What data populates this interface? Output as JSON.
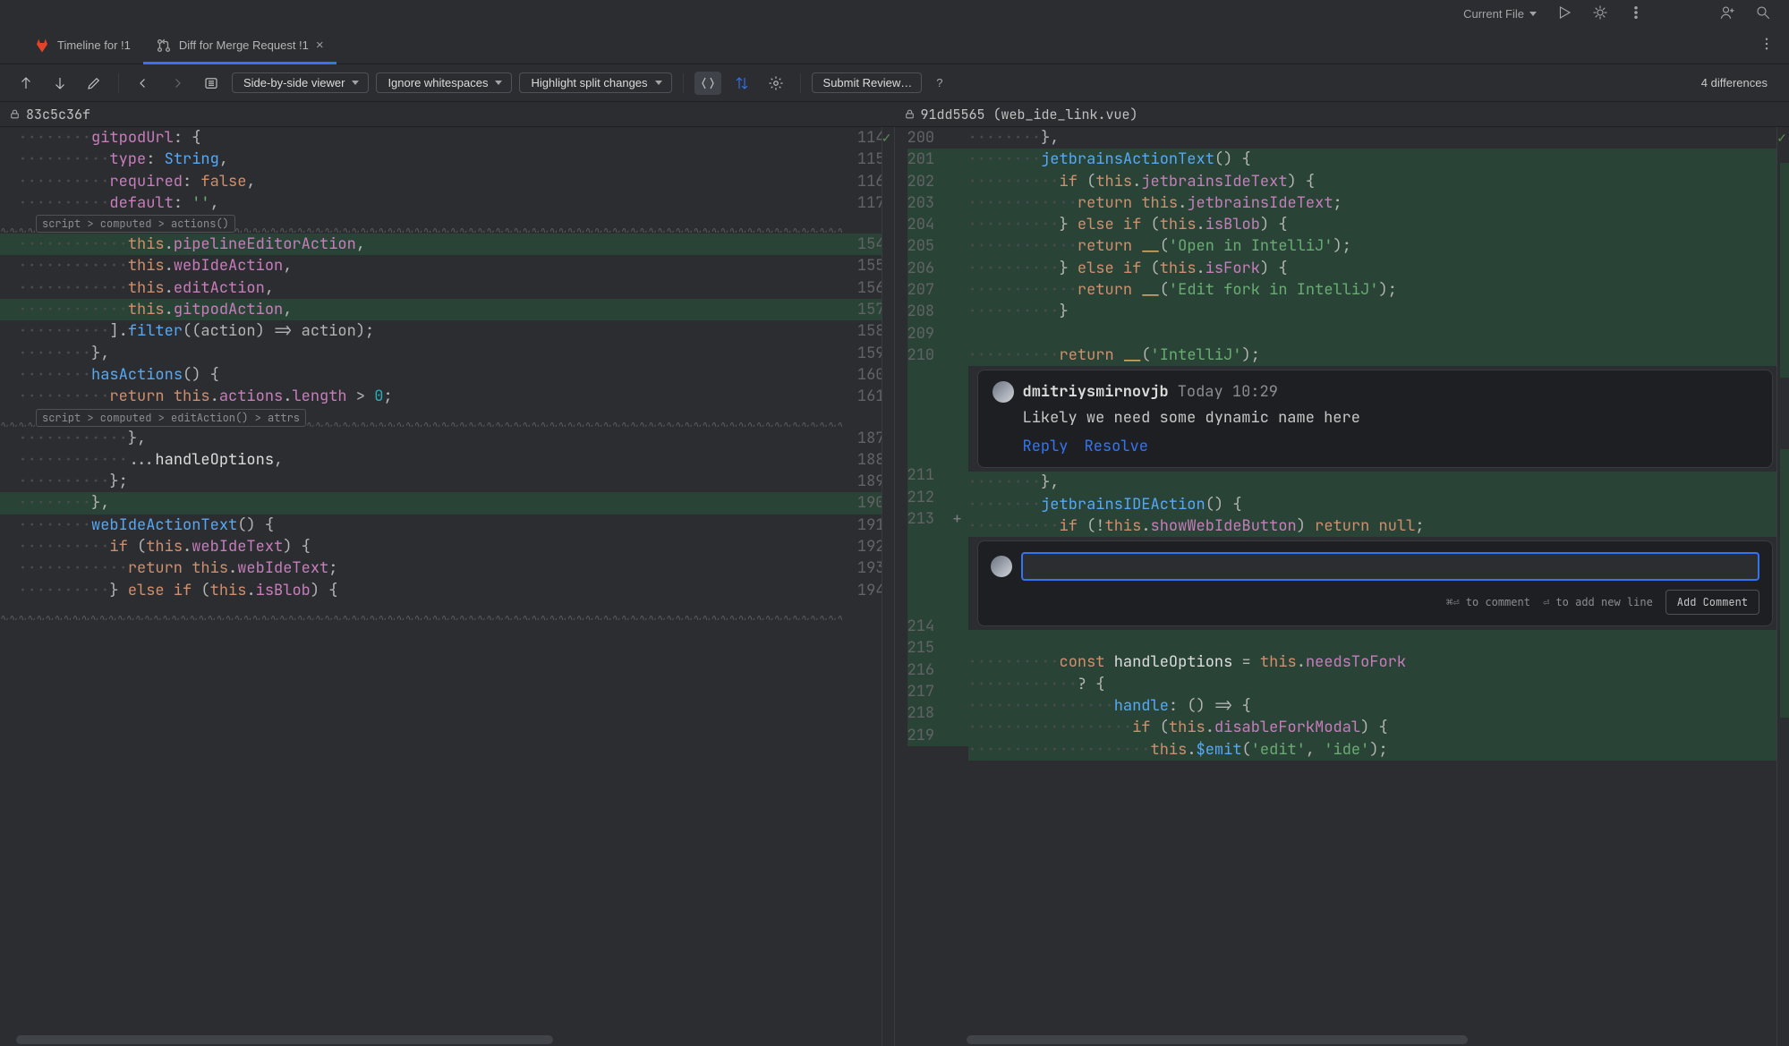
{
  "top": {
    "scope": "Current File",
    "right_icons": [
      "run-icon",
      "debug-icon",
      "more-icon",
      "add-user-icon",
      "search-icon"
    ]
  },
  "tabs": [
    {
      "label": "Timeline for !1",
      "icon": "gitlab-icon",
      "active": false,
      "closable": false
    },
    {
      "label": "Diff for Merge Request !1",
      "icon": "merge-request-icon",
      "active": true,
      "closable": true
    }
  ],
  "toolbar": {
    "viewer_mode": "Side-by-side viewer",
    "whitespace": "Ignore whitespaces",
    "highlight": "Highlight split changes",
    "submit": "Submit Review…",
    "help": "?",
    "diff_count": "4 differences"
  },
  "files": {
    "left": "83c5c36f",
    "right": "91dd5565 (web_ide_link.vue)"
  },
  "left": {
    "lines": [
      {
        "n": 114,
        "tokens": [
          [
            "ws",
            "        "
          ],
          [
            "c-prop",
            "gitpodUrl"
          ],
          [
            "c-op",
            ": {"
          ]
        ],
        "cls": ""
      },
      {
        "n": 115,
        "tokens": [
          [
            "ws",
            "          "
          ],
          [
            "c-prop",
            "type"
          ],
          [
            "c-op",
            ": "
          ],
          [
            "c-fn",
            "String"
          ],
          [
            "c-op",
            ","
          ]
        ],
        "cls": ""
      },
      {
        "n": 116,
        "tokens": [
          [
            "ws",
            "          "
          ],
          [
            "c-prop",
            "required"
          ],
          [
            "c-op",
            ": "
          ],
          [
            "c-kw",
            "false"
          ],
          [
            "c-op",
            ","
          ]
        ],
        "cls": ""
      },
      {
        "n": 117,
        "tokens": [
          [
            "ws",
            "          "
          ],
          [
            "c-prop",
            "default"
          ],
          [
            "c-op",
            ": "
          ],
          [
            "c-str",
            "''"
          ],
          [
            "c-op",
            ","
          ]
        ],
        "cls": ""
      },
      {
        "fold": "script > computed > actions()"
      },
      {
        "n": 154,
        "tokens": [
          [
            "ws",
            "            "
          ],
          [
            "c-this",
            "this"
          ],
          [
            "c-op",
            "."
          ],
          [
            "c-field",
            "pipelineEditorAction"
          ],
          [
            "c-op",
            ","
          ]
        ],
        "cls": "bg-added"
      },
      {
        "n": 155,
        "tokens": [
          [
            "ws",
            "            "
          ],
          [
            "c-this",
            "this"
          ],
          [
            "c-op",
            "."
          ],
          [
            "c-field",
            "webIdeAction"
          ],
          [
            "c-op",
            ","
          ]
        ],
        "cls": ""
      },
      {
        "n": 156,
        "tokens": [
          [
            "ws",
            "            "
          ],
          [
            "c-this",
            "this"
          ],
          [
            "c-op",
            "."
          ],
          [
            "c-field",
            "editAction"
          ],
          [
            "c-op",
            ","
          ]
        ],
        "cls": ""
      },
      {
        "n": 157,
        "tokens": [
          [
            "ws",
            "            "
          ],
          [
            "c-this",
            "this"
          ],
          [
            "c-op",
            "."
          ],
          [
            "c-field",
            "gitpodAction"
          ],
          [
            "c-op",
            ","
          ]
        ],
        "cls": "bg-added"
      },
      {
        "n": 158,
        "tokens": [
          [
            "ws",
            "          "
          ],
          [
            "c-op",
            "]."
          ],
          [
            "c-fn",
            "filter"
          ],
          [
            "c-op",
            "((action) => action);"
          ]
        ],
        "cls": ""
      },
      {
        "n": 159,
        "tokens": [
          [
            "ws",
            "        "
          ],
          [
            "c-op",
            "},"
          ]
        ],
        "cls": ""
      },
      {
        "n": 160,
        "tokens": [
          [
            "ws",
            "        "
          ],
          [
            "c-fn",
            "hasActions"
          ],
          [
            "c-op",
            "() {"
          ]
        ],
        "cls": ""
      },
      {
        "n": 161,
        "tokens": [
          [
            "ws",
            "          "
          ],
          [
            "c-kw",
            "return "
          ],
          [
            "c-this",
            "this"
          ],
          [
            "c-op",
            "."
          ],
          [
            "c-field",
            "actions"
          ],
          [
            "c-op",
            "."
          ],
          [
            "c-field",
            "length"
          ],
          [
            "c-op",
            " > "
          ],
          [
            "c-num",
            "0"
          ],
          [
            "c-op",
            ";"
          ]
        ],
        "cls": ""
      },
      {
        "fold": "script > computed > editAction() > attrs"
      },
      {
        "n": 187,
        "tokens": [
          [
            "ws",
            "            "
          ],
          [
            "c-op",
            "},"
          ]
        ],
        "cls": ""
      },
      {
        "n": 188,
        "tokens": [
          [
            "ws",
            "            "
          ],
          [
            "c-op",
            "..."
          ],
          [
            "c-id",
            "handleOptions"
          ],
          [
            "c-op",
            ","
          ]
        ],
        "cls": ""
      },
      {
        "n": 189,
        "tokens": [
          [
            "ws",
            "          "
          ],
          [
            "c-op",
            "};"
          ]
        ],
        "cls": ""
      },
      {
        "n": 190,
        "tokens": [
          [
            "ws",
            "        "
          ],
          [
            "c-op",
            "},"
          ]
        ],
        "cls": "bg-added"
      },
      {
        "n": 191,
        "tokens": [
          [
            "ws",
            "        "
          ],
          [
            "c-fn",
            "webIdeActionText"
          ],
          [
            "c-op",
            "() {"
          ]
        ],
        "cls": ""
      },
      {
        "n": 192,
        "tokens": [
          [
            "ws",
            "          "
          ],
          [
            "c-kw",
            "if "
          ],
          [
            "c-op",
            "("
          ],
          [
            "c-this",
            "this"
          ],
          [
            "c-op",
            "."
          ],
          [
            "c-field",
            "webIdeText"
          ],
          [
            "c-op",
            ") {"
          ]
        ],
        "cls": ""
      },
      {
        "n": 193,
        "tokens": [
          [
            "ws",
            "            "
          ],
          [
            "c-kw",
            "return "
          ],
          [
            "c-this",
            "this"
          ],
          [
            "c-op",
            "."
          ],
          [
            "c-field",
            "webIdeText"
          ],
          [
            "c-op",
            ";"
          ]
        ],
        "cls": ""
      },
      {
        "n": 194,
        "tokens": [
          [
            "ws",
            "          "
          ],
          [
            "c-op",
            "} "
          ],
          [
            "c-kw",
            "else if "
          ],
          [
            "c-op",
            "("
          ],
          [
            "c-this",
            "this"
          ],
          [
            "c-op",
            "."
          ],
          [
            "c-field",
            "isBlob"
          ],
          [
            "c-op",
            ") {"
          ]
        ],
        "cls": ""
      },
      {
        "fold": ""
      }
    ]
  },
  "right": {
    "lines": [
      {
        "n": 200,
        "tokens": [
          [
            "ws",
            "        "
          ],
          [
            "c-op",
            "},"
          ]
        ],
        "cls": ""
      },
      {
        "n": 201,
        "tokens": [
          [
            "ws",
            "        "
          ],
          [
            "c-fn",
            "jetbrainsActionText"
          ],
          [
            "c-op",
            "() {"
          ]
        ],
        "cls": "bg-added"
      },
      {
        "n": 202,
        "tokens": [
          [
            "ws",
            "          "
          ],
          [
            "c-kw",
            "if "
          ],
          [
            "c-op",
            "("
          ],
          [
            "c-this",
            "this"
          ],
          [
            "c-op",
            "."
          ],
          [
            "c-field",
            "jetbrainsIdeText"
          ],
          [
            "c-op",
            ") {"
          ]
        ],
        "cls": "bg-added"
      },
      {
        "n": 203,
        "tokens": [
          [
            "ws",
            "            "
          ],
          [
            "c-kw",
            "return "
          ],
          [
            "c-this",
            "this"
          ],
          [
            "c-op",
            "."
          ],
          [
            "c-field",
            "jetbrainsIdeText"
          ],
          [
            "c-op",
            ";"
          ]
        ],
        "cls": "bg-added"
      },
      {
        "n": 204,
        "tokens": [
          [
            "ws",
            "          "
          ],
          [
            "c-op",
            "} "
          ],
          [
            "c-kw",
            "else if "
          ],
          [
            "c-op",
            "("
          ],
          [
            "c-this",
            "this"
          ],
          [
            "c-op",
            "."
          ],
          [
            "c-field",
            "isBlob"
          ],
          [
            "c-op",
            ") {"
          ]
        ],
        "cls": "bg-added"
      },
      {
        "n": 205,
        "tokens": [
          [
            "ws",
            "            "
          ],
          [
            "c-kw",
            "return "
          ],
          [
            "c-builtin",
            "__"
          ],
          [
            "c-op",
            "("
          ],
          [
            "c-str",
            "'Open in IntelliJ'"
          ],
          [
            "c-op",
            ");"
          ]
        ],
        "cls": "bg-added"
      },
      {
        "n": 206,
        "tokens": [
          [
            "ws",
            "          "
          ],
          [
            "c-op",
            "} "
          ],
          [
            "c-kw",
            "else if "
          ],
          [
            "c-op",
            "("
          ],
          [
            "c-this",
            "this"
          ],
          [
            "c-op",
            "."
          ],
          [
            "c-field",
            "isFork"
          ],
          [
            "c-op",
            ") {"
          ]
        ],
        "cls": "bg-added"
      },
      {
        "n": 207,
        "tokens": [
          [
            "ws",
            "            "
          ],
          [
            "c-kw",
            "return "
          ],
          [
            "c-builtin",
            "__"
          ],
          [
            "c-op",
            "("
          ],
          [
            "c-str",
            "'Edit fork in IntelliJ'"
          ],
          [
            "c-op",
            ");"
          ]
        ],
        "cls": "bg-added"
      },
      {
        "n": 208,
        "tokens": [
          [
            "ws",
            "          "
          ],
          [
            "c-op",
            "}"
          ]
        ],
        "cls": "bg-added"
      },
      {
        "n": 209,
        "tokens": [
          [
            "ws",
            ""
          ]
        ],
        "cls": "bg-added"
      },
      {
        "n": 210,
        "tokens": [
          [
            "ws",
            "          "
          ],
          [
            "c-kw",
            "return "
          ],
          [
            "c-builtin",
            "__"
          ],
          [
            "c-op",
            "("
          ],
          [
            "c-str",
            "'IntelliJ'"
          ],
          [
            "c-op",
            ");"
          ]
        ],
        "cls": "bg-added"
      },
      {
        "comment": true
      },
      {
        "n": 211,
        "tokens": [
          [
            "ws",
            "        "
          ],
          [
            "c-op",
            "},"
          ]
        ],
        "cls": "bg-added"
      },
      {
        "n": 212,
        "tokens": [
          [
            "ws",
            "        "
          ],
          [
            "c-fn",
            "jetbrainsIDEAction"
          ],
          [
            "c-op",
            "() {"
          ]
        ],
        "cls": "bg-added"
      },
      {
        "n": 213,
        "plus": true,
        "tokens": [
          [
            "ws",
            "          "
          ],
          [
            "c-kw",
            "if "
          ],
          [
            "c-op",
            "(!"
          ],
          [
            "c-this",
            "this"
          ],
          [
            "c-op",
            "."
          ],
          [
            "c-field",
            "showWebIdeButton"
          ],
          [
            "c-op",
            ") "
          ],
          [
            "c-kw",
            "return "
          ],
          [
            "c-kw",
            "null"
          ],
          [
            "c-op",
            ";"
          ]
        ],
        "cls": "bg-added"
      },
      {
        "reply": true
      },
      {
        "n": 214,
        "tokens": [
          [
            "ws",
            ""
          ]
        ],
        "cls": "bg-added"
      },
      {
        "n": 215,
        "tokens": [
          [
            "ws",
            "          "
          ],
          [
            "c-kw",
            "const "
          ],
          [
            "c-id",
            "handleOptions"
          ],
          [
            "c-op",
            " = "
          ],
          [
            "c-this",
            "this"
          ],
          [
            "c-op",
            "."
          ],
          [
            "c-field",
            "needsToFork"
          ]
        ],
        "cls": "bg-added"
      },
      {
        "n": 216,
        "tokens": [
          [
            "ws",
            "            "
          ],
          [
            "c-op",
            "? {"
          ]
        ],
        "cls": "bg-added"
      },
      {
        "n": 217,
        "tokens": [
          [
            "ws",
            "                "
          ],
          [
            "c-fn",
            "handle"
          ],
          [
            "c-op",
            ": () => {"
          ]
        ],
        "cls": "bg-added"
      },
      {
        "n": 218,
        "tokens": [
          [
            "ws",
            "                  "
          ],
          [
            "c-kw",
            "if "
          ],
          [
            "c-op",
            "("
          ],
          [
            "c-this",
            "this"
          ],
          [
            "c-op",
            "."
          ],
          [
            "c-field",
            "disableForkModal"
          ],
          [
            "c-op",
            ") {"
          ]
        ],
        "cls": "bg-added"
      },
      {
        "n": 219,
        "tokens": [
          [
            "ws",
            "                    "
          ],
          [
            "c-this",
            "this"
          ],
          [
            "c-op",
            "."
          ],
          [
            "c-fn",
            "$emit"
          ],
          [
            "c-op",
            "("
          ],
          [
            "c-str",
            "'edit'"
          ],
          [
            "c-op",
            ", "
          ],
          [
            "c-str",
            "'ide'"
          ],
          [
            "c-op",
            ");"
          ]
        ],
        "cls": "bg-added"
      }
    ]
  },
  "comment": {
    "author": "dmitriysmirnovjb",
    "time": "Today 10:29",
    "body": "Likely we need some dynamic name here",
    "reply": "Reply",
    "resolve": "Resolve"
  },
  "reply": {
    "hint_comment": "⌘⏎ to comment",
    "hint_newline": "⏎ to add new line",
    "button": "Add Comment"
  }
}
